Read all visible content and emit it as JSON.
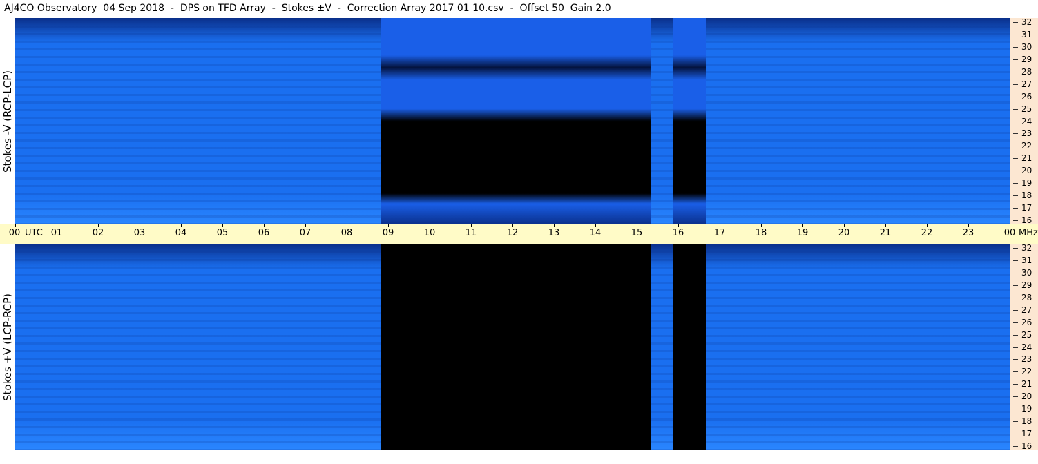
{
  "title": "AJ4CO Observatory  04 Sep 2018  -  DPS on TFD Array  -  Stokes ±V  -  Correction Array 2017 01 10.csv  -  Offset 50  Gain 2.0",
  "panels": {
    "top_label": "Stokes -V (RCP-LCP)",
    "bottom_label": "Stokes +V (LCP-RCP)"
  },
  "time_axis": {
    "unit_label": "UTC",
    "freq_unit_label": "MHz",
    "ticks": [
      "00",
      "01",
      "02",
      "03",
      "04",
      "05",
      "06",
      "07",
      "08",
      "09",
      "10",
      "11",
      "12",
      "13",
      "14",
      "15",
      "16",
      "17",
      "18",
      "19",
      "20",
      "21",
      "22",
      "23",
      "00"
    ]
  },
  "freq_axis": {
    "ticks": [
      "32",
      "31",
      "30",
      "29",
      "28",
      "27",
      "26",
      "25",
      "24",
      "23",
      "22",
      "21",
      "20",
      "19",
      "18",
      "17",
      "16"
    ]
  },
  "colors": {
    "background_blue": "#1a6ff0",
    "dark_blue": "#0a2f8a",
    "bright_blue": "#2a86ff",
    "no_data": "#000000",
    "time_axis_bg": "#fffbc7",
    "freq_axis_bg": "#fce7d2"
  },
  "chart_data": {
    "type": "heatmap",
    "x_unit": "UTC hour",
    "y_unit": "MHz",
    "xlim": [
      0,
      24
    ],
    "ylim": [
      16,
      32
    ],
    "panels": [
      "Stokes -V (RCP-LCP)",
      "Stokes +V (LCP-RCP)"
    ],
    "no_data_intervals_utc": [
      [
        8.83,
        15.35
      ],
      [
        15.88,
        16.67
      ]
    ]
  }
}
